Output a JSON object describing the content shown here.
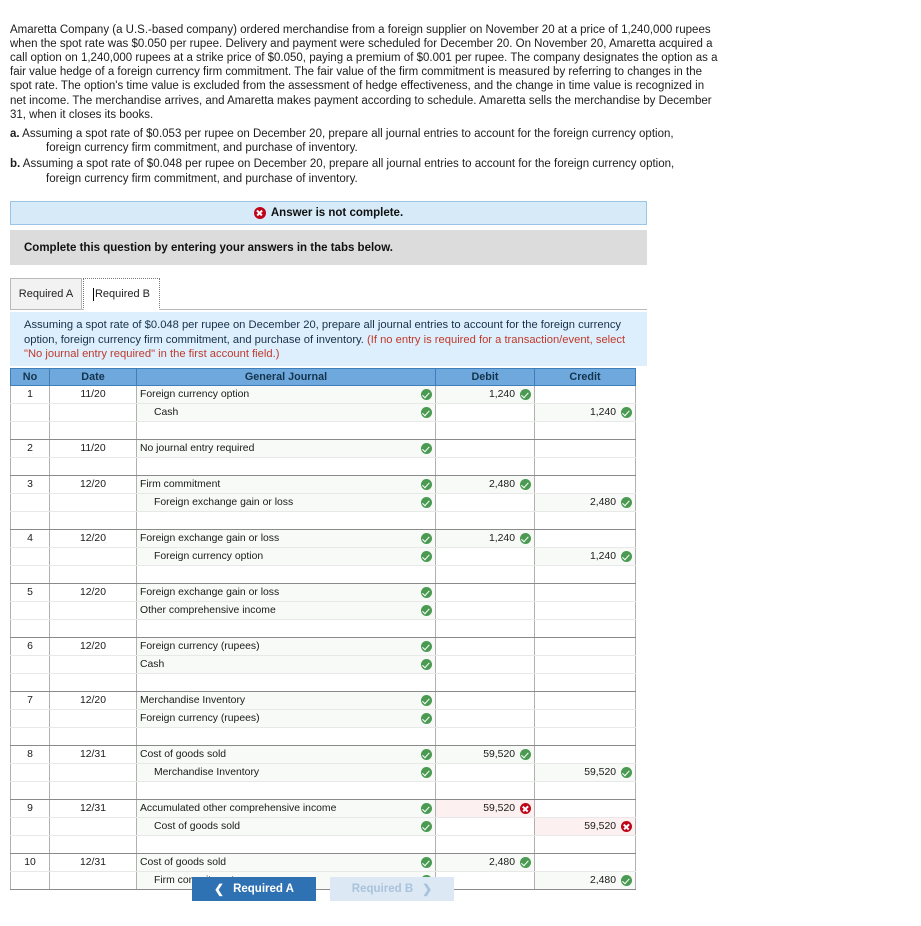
{
  "problem": {
    "narrative": "Amaretta Company (a U.S.-based company) ordered merchandise from a foreign supplier on November 20 at a price of 1,240,000 rupees when the spot rate was $0.050 per rupee. Delivery and payment were scheduled for December 20. On November 20, Amaretta acquired a call option on 1,240,000 rupees at a strike price of $0.050, paying a premium of $0.001 per rupee. The company designates the option as a fair value hedge of a foreign currency firm commitment. The fair value of the firm commitment is measured by referring to changes in the spot rate. The option's time value is excluded from the assessment of hedge effectiveness, and the change in time value is recognized in net income. The merchandise arrives, and Amaretta makes payment according to schedule. Amaretta sells the merchandise by December 31, when it closes its books.",
    "requirements": [
      {
        "marker": "a.",
        "line1": "Assuming a spot rate of $0.053 per rupee on December 20, prepare all journal entries to account for the foreign currency option,",
        "line2": "foreign currency firm commitment, and purchase of inventory."
      },
      {
        "marker": "b.",
        "line1": "Assuming a spot rate of $0.048 per rupee on December 20, prepare all journal entries to account for the foreign currency option,",
        "line2": "foreign currency firm commitment, and purchase of inventory."
      }
    ]
  },
  "alert": {
    "icon": "x-circle-icon",
    "text": "Answer is not complete."
  },
  "instruction": {
    "text": "Complete this question by entering your answers in the tabs below."
  },
  "tabs": [
    {
      "label": "Required A",
      "active": false
    },
    {
      "label": "Required B",
      "active": true
    }
  ],
  "question_banner": {
    "main": "Assuming a spot rate of $0.048 per rupee on December 20, prepare all journal entries to account for the foreign currency option, foreign currency firm commitment, and purchase of inventory.",
    "hint": "(If no entry is required for a transaction/event, select \"No journal entry required\" in the first account field.)"
  },
  "table": {
    "headers": [
      "No",
      "Date",
      "General Journal",
      "Debit",
      "Credit"
    ],
    "entries": [
      {
        "no": "1",
        "date": "11/20",
        "lines": [
          {
            "account": "Foreign currency option",
            "indent": false,
            "acct_mark": "ok",
            "debit": "1,240",
            "debit_mark": "ok",
            "credit": "",
            "credit_mark": "none"
          },
          {
            "account": "Cash",
            "indent": true,
            "acct_mark": "ok",
            "debit": "",
            "debit_mark": "none",
            "credit": "1,240",
            "credit_mark": "ok"
          },
          {
            "account": "",
            "indent": false,
            "acct_mark": "none",
            "debit": "",
            "debit_mark": "none",
            "credit": "",
            "credit_mark": "none"
          }
        ]
      },
      {
        "no": "2",
        "date": "11/20",
        "lines": [
          {
            "account": "No journal entry required",
            "indent": false,
            "acct_mark": "ok",
            "debit": "",
            "debit_mark": "none",
            "credit": "",
            "credit_mark": "none"
          },
          {
            "account": "",
            "indent": false,
            "acct_mark": "none",
            "debit": "",
            "debit_mark": "none",
            "credit": "",
            "credit_mark": "none"
          }
        ]
      },
      {
        "no": "3",
        "date": "12/20",
        "lines": [
          {
            "account": "Firm commitment",
            "indent": false,
            "acct_mark": "ok",
            "debit": "2,480",
            "debit_mark": "ok",
            "credit": "",
            "credit_mark": "none"
          },
          {
            "account": "Foreign exchange gain or loss",
            "indent": true,
            "acct_mark": "ok",
            "debit": "",
            "debit_mark": "none",
            "credit": "2,480",
            "credit_mark": "ok"
          },
          {
            "account": "",
            "indent": false,
            "acct_mark": "none",
            "debit": "",
            "debit_mark": "none",
            "credit": "",
            "credit_mark": "none"
          }
        ]
      },
      {
        "no": "4",
        "date": "12/20",
        "lines": [
          {
            "account": "Foreign exchange gain or loss",
            "indent": false,
            "acct_mark": "ok",
            "debit": "1,240",
            "debit_mark": "ok",
            "credit": "",
            "credit_mark": "none"
          },
          {
            "account": "Foreign currency option",
            "indent": true,
            "acct_mark": "ok",
            "debit": "",
            "debit_mark": "none",
            "credit": "1,240",
            "credit_mark": "ok"
          },
          {
            "account": "",
            "indent": false,
            "acct_mark": "none",
            "debit": "",
            "debit_mark": "none",
            "credit": "",
            "credit_mark": "none"
          }
        ]
      },
      {
        "no": "5",
        "date": "12/20",
        "lines": [
          {
            "account": "Foreign exchange gain or loss",
            "indent": false,
            "acct_mark": "ok",
            "debit": "",
            "debit_mark": "none",
            "credit": "",
            "credit_mark": "none"
          },
          {
            "account": "Other comprehensive income",
            "indent": false,
            "acct_mark": "ok",
            "debit": "",
            "debit_mark": "none",
            "credit": "",
            "credit_mark": "none"
          },
          {
            "account": "",
            "indent": false,
            "acct_mark": "none",
            "debit": "",
            "debit_mark": "none",
            "credit": "",
            "credit_mark": "none"
          }
        ]
      },
      {
        "no": "6",
        "date": "12/20",
        "lines": [
          {
            "account": "Foreign currency (rupees)",
            "indent": false,
            "acct_mark": "ok",
            "debit": "",
            "debit_mark": "none",
            "credit": "",
            "credit_mark": "none"
          },
          {
            "account": "Cash",
            "indent": false,
            "acct_mark": "ok",
            "debit": "",
            "debit_mark": "none",
            "credit": "",
            "credit_mark": "none"
          },
          {
            "account": "",
            "indent": false,
            "acct_mark": "none",
            "debit": "",
            "debit_mark": "none",
            "credit": "",
            "credit_mark": "none"
          }
        ]
      },
      {
        "no": "7",
        "date": "12/20",
        "lines": [
          {
            "account": "Merchandise Inventory",
            "indent": false,
            "acct_mark": "ok",
            "debit": "",
            "debit_mark": "none",
            "credit": "",
            "credit_mark": "none"
          },
          {
            "account": "Foreign currency (rupees)",
            "indent": false,
            "acct_mark": "ok",
            "debit": "",
            "debit_mark": "none",
            "credit": "",
            "credit_mark": "none"
          },
          {
            "account": "",
            "indent": false,
            "acct_mark": "none",
            "debit": "",
            "debit_mark": "none",
            "credit": "",
            "credit_mark": "none"
          }
        ]
      },
      {
        "no": "8",
        "date": "12/31",
        "lines": [
          {
            "account": "Cost of goods sold",
            "indent": false,
            "acct_mark": "ok",
            "debit": "59,520",
            "debit_mark": "ok",
            "credit": "",
            "credit_mark": "none"
          },
          {
            "account": "Merchandise Inventory",
            "indent": true,
            "acct_mark": "ok",
            "debit": "",
            "debit_mark": "none",
            "credit": "59,520",
            "credit_mark": "ok"
          },
          {
            "account": "",
            "indent": false,
            "acct_mark": "none",
            "debit": "",
            "debit_mark": "none",
            "credit": "",
            "credit_mark": "none"
          }
        ]
      },
      {
        "no": "9",
        "date": "12/31",
        "lines": [
          {
            "account": "Accumulated other comprehensive income",
            "indent": false,
            "acct_mark": "ok",
            "debit": "59,520",
            "debit_mark": "bad",
            "credit": "",
            "credit_mark": "none"
          },
          {
            "account": "Cost of goods sold",
            "indent": true,
            "acct_mark": "ok",
            "debit": "",
            "debit_mark": "none",
            "credit": "59,520",
            "credit_mark": "bad"
          },
          {
            "account": "",
            "indent": false,
            "acct_mark": "none",
            "debit": "",
            "debit_mark": "none",
            "credit": "",
            "credit_mark": "none"
          }
        ]
      },
      {
        "no": "10",
        "date": "12/31",
        "lines": [
          {
            "account": "Cost of goods sold",
            "indent": false,
            "acct_mark": "ok",
            "debit": "2,480",
            "debit_mark": "ok",
            "credit": "",
            "credit_mark": "none"
          },
          {
            "account": "Firm commitment",
            "indent": true,
            "acct_mark": "ok",
            "debit": "",
            "debit_mark": "none",
            "credit": "2,480",
            "credit_mark": "ok"
          }
        ]
      }
    ]
  },
  "nav": {
    "prev": {
      "label": "Required A",
      "icon": "chevron-left-icon"
    },
    "next": {
      "label": "Required B",
      "icon": "chevron-right-icon"
    }
  },
  "colors": {
    "header_blue": "#6fa8dc",
    "banner_blue": "#ddeffc",
    "alert_blue": "#d6eaf8",
    "instruct_gray": "#dcdcdc",
    "ok_green": "#4a9a52",
    "error_red": "#c00418",
    "primary_button": "#2f72b4",
    "disabled_button": "#dce8f3",
    "hint_red": "#c0392b"
  }
}
